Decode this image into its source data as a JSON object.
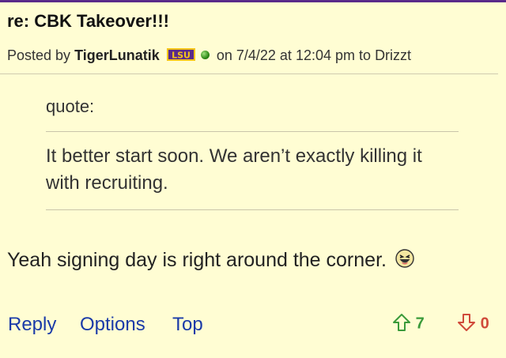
{
  "post": {
    "title": "re: CBK Takeover!!!",
    "posted_by_label": "Posted by",
    "author": "TigerLunatik",
    "team_badge": "LSU",
    "on_label": "on",
    "date": "7/4/22",
    "at_label": "at",
    "time": "12:04 pm",
    "to_label": "to",
    "recipient": "Drizzt"
  },
  "quote": {
    "label": "quote:",
    "text": "It better start soon. We aren’t exactly killing it with recruiting."
  },
  "body": {
    "text": "Yeah signing day is right around the corner.",
    "emoji_icon": "laughing-emoji-icon"
  },
  "actions": {
    "reply": "Reply",
    "options": "Options",
    "top": "Top"
  },
  "votes": {
    "up": "7",
    "down": "0"
  },
  "colors": {
    "background": "#fffdd3",
    "link": "#1a3aa8",
    "upvote": "#3a9a3a",
    "downvote": "#d04a3a",
    "top_border": "#5a2a8a"
  }
}
